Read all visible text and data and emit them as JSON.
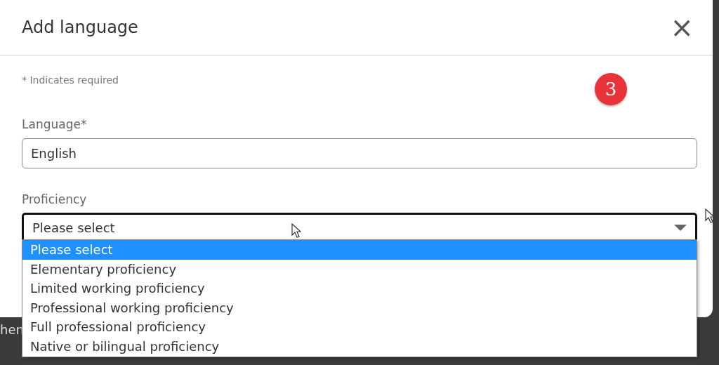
{
  "dialog": {
    "title": "Add language",
    "close": "×",
    "required_note": "* Indicates required",
    "badge": "3"
  },
  "fields": [
    {
      "label": "Language*",
      "value": "English"
    },
    {
      "label": "Proficiency",
      "value": "Please select",
      "expanded": true
    }
  ],
  "options": [
    {
      "label": "Please select",
      "selected": true
    },
    {
      "label": "Elementary proficiency",
      "selected": false
    },
    {
      "label": "Limited working proficiency",
      "selected": false
    },
    {
      "label": "Professional working proficiency",
      "selected": false
    },
    {
      "label": "Full professional proficiency",
      "selected": false
    },
    {
      "label": "Native or bilingual proficiency",
      "selected": false
    }
  ],
  "background_text": "hen"
}
